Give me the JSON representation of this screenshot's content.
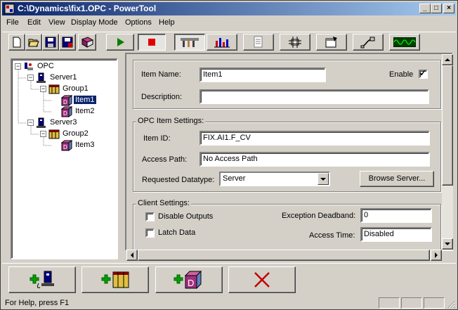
{
  "window": {
    "title": "C:\\Dynamics\\fix1.OPC - PowerTool",
    "minimize": "_",
    "maximize": "□",
    "close": "×"
  },
  "menu": [
    "File",
    "Edit",
    "View",
    "Display Mode",
    "Options",
    "Help"
  ],
  "toolbar": {
    "buttons": [
      "new-icon",
      "open-icon",
      "save-icon",
      "save-all-icon",
      "book-icon",
      "play-icon",
      "stop-icon",
      "tools-icon",
      "statistics-icon",
      "notes-icon",
      "network-icon",
      "properties-icon",
      "connect-icon",
      "waveform-icon"
    ],
    "pressed": "tools-icon"
  },
  "tree": {
    "root": "OPC",
    "servers": [
      {
        "label": "Server1",
        "groups": [
          {
            "label": "Group1",
            "items": [
              "Item1",
              "Item2"
            ]
          }
        ]
      },
      {
        "label": "Server3",
        "groups": [
          {
            "label": "Group2",
            "items": [
              "Item3"
            ]
          }
        ]
      }
    ],
    "selected": "Item1"
  },
  "item": {
    "name_label": "Item Name:",
    "name_value": "Item1",
    "enable_label": "Enable",
    "enable_checked": "✓",
    "description_label": "Description:",
    "description_value": ""
  },
  "opc_settings": {
    "title": "OPC Item Settings:",
    "item_id_label": "Item ID:",
    "item_id_value": "FIX.AI1.F_CV",
    "access_path_label": "Access Path:",
    "access_path_value": "No Access Path",
    "datatype_label": "Requested Datatype:",
    "datatype_value": "Server",
    "browse_button": "Browse Server..."
  },
  "client_settings": {
    "title": "Client Settings:",
    "disable_outputs_label": "Disable Outputs",
    "latch_data_label": "Latch Data",
    "exception_deadband_label": "Exception Deadband:",
    "exception_deadband_value": "0",
    "access_time_label": "Access Time:",
    "access_time_value": "Disabled"
  },
  "actions": [
    "add-server-icon",
    "add-group-icon",
    "add-item-icon",
    "delete-icon"
  ],
  "status": {
    "help_text": "For Help, press F1"
  },
  "colors": {
    "title_active": "#0a246a",
    "selection": "#0a246a",
    "play": "#008000",
    "stop": "#e00000",
    "delete": "#c00000"
  }
}
